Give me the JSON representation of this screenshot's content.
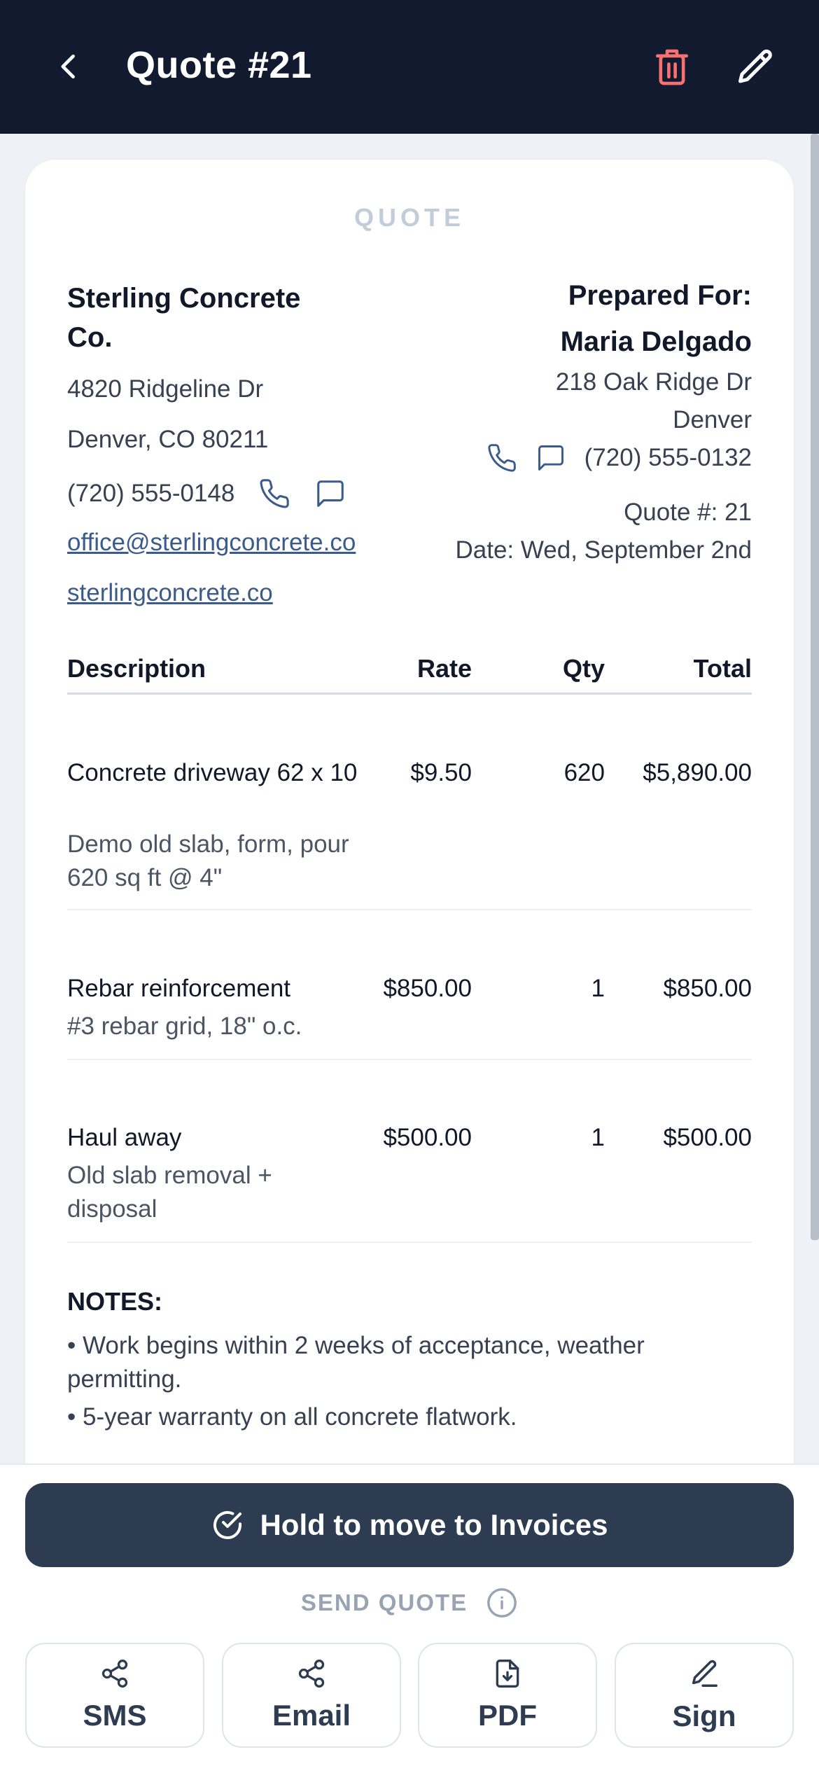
{
  "header": {
    "title": "Quote #21",
    "back_icon": "chevron-left-icon",
    "delete_icon": "trash-icon",
    "edit_icon": "pencil-icon",
    "delete_color": "#f87171"
  },
  "card": {
    "label": "QUOTE"
  },
  "company": {
    "name": "Sterling Concrete Co.",
    "address1": "4820 Ridgeline Dr",
    "address2": "Denver, CO 80211",
    "phone": "(720) 555-0148",
    "email": "office@sterlingconcrete.co",
    "website": "sterlingconcrete.co"
  },
  "client": {
    "heading": "Prepared For:",
    "name": "Maria Delgado",
    "address1": "218 Oak Ridge Dr",
    "city": "Denver",
    "phone": "(720) 555-0132",
    "quote_number": "Quote #: 21",
    "date": "Date: Wed, September 2nd"
  },
  "table": {
    "headers": {
      "description": "Description",
      "rate": "Rate",
      "qty": "Qty",
      "total": "Total"
    },
    "rows": [
      {
        "title": "Concrete driveway 62 x 10",
        "detail": "Demo old slab, form, pour 620 sq ft @ 4\"",
        "rate": "$9.50",
        "qty": "620",
        "total": "$5,890.00"
      },
      {
        "title": "Rebar reinforcement",
        "detail": "#3 rebar grid, 18\" o.c.",
        "rate": "$850.00",
        "qty": "1",
        "total": "$850.00"
      },
      {
        "title": "Haul away",
        "detail": "Old slab removal + disposal",
        "rate": "$500.00",
        "qty": "1",
        "total": "$500.00"
      }
    ]
  },
  "notes": {
    "title": "NOTES:",
    "items": [
      "• Work begins within 2 weeks of acceptance, weather permitting.",
      "• 5-year warranty on all concrete flatwork."
    ]
  },
  "actions": {
    "hold_label": "Hold to move to Invoices",
    "send_label": "SEND QUOTE",
    "sms": "SMS",
    "email": "Email",
    "pdf": "PDF",
    "sign": "Sign"
  }
}
